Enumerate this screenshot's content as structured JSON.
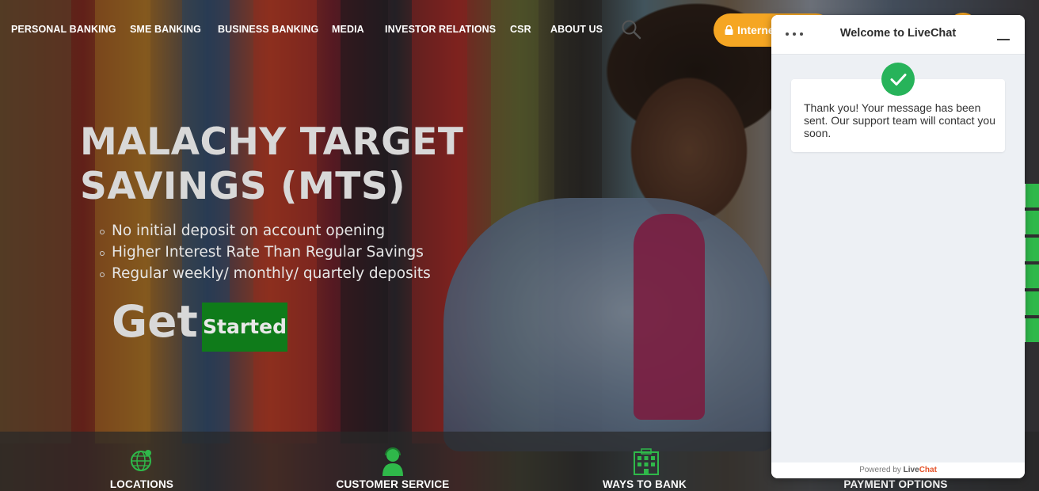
{
  "nav": {
    "items": [
      {
        "label": "PERSONAL BANKING"
      },
      {
        "label": "SME BANKING"
      },
      {
        "label": "BUSINESS BANKING"
      },
      {
        "label": "MEDIA"
      },
      {
        "label": "INVESTOR RELATIONS"
      },
      {
        "label": "CSR"
      },
      {
        "label": "ABOUT US"
      }
    ],
    "internet_banking_label": "Interne"
  },
  "hero": {
    "title": "MALACHY TARGET SAVINGS (MTS)",
    "features": [
      "No initial deposit on account opening",
      "Higher Interest Rate Than Regular Savings",
      "Regular weekly/ monthly/ quartely deposits"
    ],
    "cta_prefix": "Get",
    "cta_button": "Started"
  },
  "quick_links": [
    {
      "label": "LOCATIONS",
      "icon": "globe-pin-icon"
    },
    {
      "label": "CUSTOMER SERVICE",
      "icon": "support-agent-icon"
    },
    {
      "label": "WAYS TO BANK",
      "icon": "bank-building-icon"
    },
    {
      "label": "PAYMENT OPTIONS",
      "icon": "payment-icon"
    }
  ],
  "livechat": {
    "title": "Welcome to LiveChat",
    "message": "Thank you! Your message has been sent. Our support team will contact you soon.",
    "footer_prefix": "Powered by",
    "footer_brand_live": "Live",
    "footer_brand_chat": "Chat"
  },
  "colors": {
    "accent_green": "#0f7b1a",
    "accent_orange": "#f5a623",
    "success_green": "#27b35a",
    "livechat_orange": "#e5542b"
  }
}
